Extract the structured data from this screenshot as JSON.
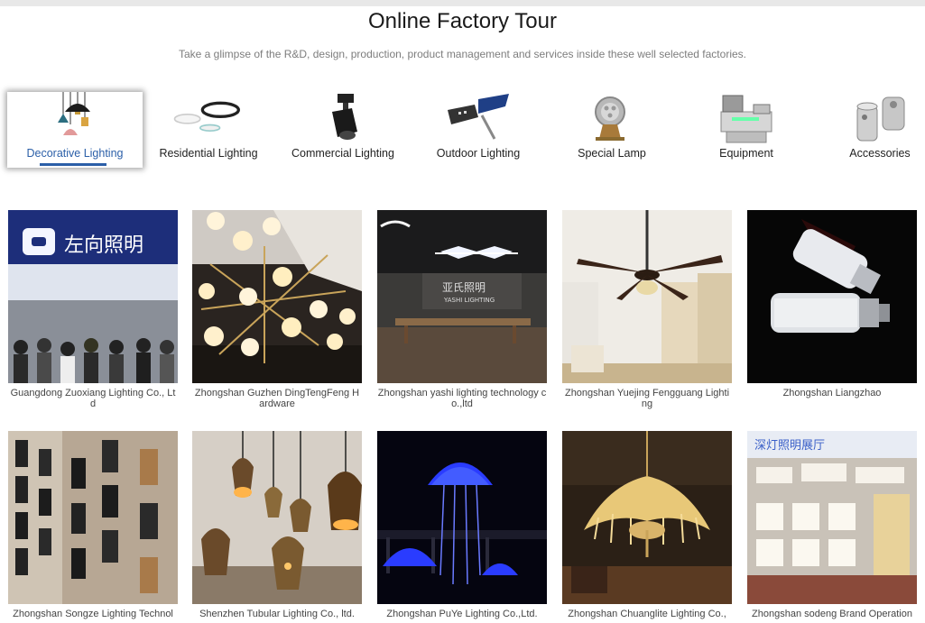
{
  "page": {
    "title": "Online Factory Tour",
    "subtitle": "Take a glimpse of the R&D, design, production, product management and services inside these well selected factories."
  },
  "categories": [
    {
      "label": "Decorative Lighting",
      "icon": "pendant-lamp-icon",
      "active": true
    },
    {
      "label": "Residential Lighting",
      "icon": "ceiling-light-icon",
      "active": false
    },
    {
      "label": "Commercial Lighting",
      "icon": "track-spotlight-icon",
      "active": false
    },
    {
      "label": "Outdoor Lighting",
      "icon": "solar-street-light-icon",
      "active": false
    },
    {
      "label": "Special Lamp",
      "icon": "underwater-spotlight-icon",
      "active": false
    },
    {
      "label": "Equipment",
      "icon": "machine-icon",
      "active": false
    },
    {
      "label": "Accessories",
      "icon": "metal-fitting-icon",
      "active": false
    }
  ],
  "factories": [
    {
      "name": "Guangdong Zuoxiang Lighting Co., Ltd",
      "sign_text": "左向照明"
    },
    {
      "name": "Zhongshan Guzhen DingTengFeng Hardware"
    },
    {
      "name": "Zhongshan yashi lighting technology co.,ltd",
      "sign_text": "亚氏照明",
      "sign_sub": "YASHI LIGHTING"
    },
    {
      "name": "Zhongshan Yuejing Fengguang Lighting"
    },
    {
      "name": "Zhongshan Liangzhao"
    },
    {
      "name": "Zhongshan Songze Lighting Technol"
    },
    {
      "name": "Shenzhen Tubular Lighting Co., ltd."
    },
    {
      "name": "Zhongshan PuYe Lighting Co.,Ltd."
    },
    {
      "name": "Zhongshan Chuanglite Lighting Co.,"
    },
    {
      "name": "Zhongshan sodeng Brand Operation",
      "sign_text": "深灯照明展厅"
    }
  ],
  "colors": {
    "accent": "#2b5fa8",
    "title": "#1a1a1a",
    "subtitle": "#7d7d7d"
  }
}
